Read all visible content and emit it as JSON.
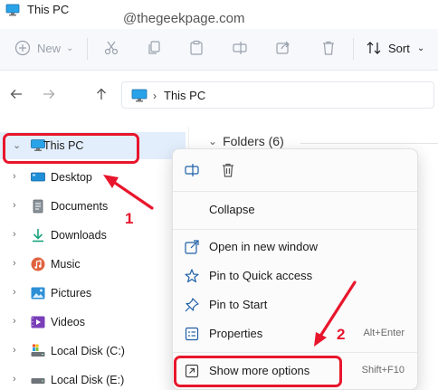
{
  "window": {
    "title": "This PC"
  },
  "watermark": "@thegeekpage.com",
  "toolbar": {
    "new_label": "New",
    "sort_label": "Sort"
  },
  "address": {
    "crumb": "This PC"
  },
  "sidebar": {
    "items": [
      {
        "label": "This PC",
        "icon": "monitor-icon",
        "expander": "⌄",
        "selected": true
      },
      {
        "label": "Desktop",
        "icon": "desktop-icon"
      },
      {
        "label": "Documents",
        "icon": "documents-icon"
      },
      {
        "label": "Downloads",
        "icon": "downloads-icon"
      },
      {
        "label": "Music",
        "icon": "music-icon"
      },
      {
        "label": "Pictures",
        "icon": "pictures-icon"
      },
      {
        "label": "Videos",
        "icon": "videos-icon"
      },
      {
        "label": "Local Disk (C:)",
        "icon": "drive-icon"
      },
      {
        "label": "Local Disk (E:)",
        "icon": "drive-icon"
      }
    ]
  },
  "main": {
    "folders_header": "Folders (6)"
  },
  "context_menu": {
    "collapse": "Collapse",
    "open_new_window": "Open in new window",
    "pin_quick_access": "Pin to Quick access",
    "pin_start": "Pin to Start",
    "properties": "Properties",
    "properties_shortcut": "Alt+Enter",
    "show_more": "Show more options",
    "show_more_shortcut": "Shift+F10"
  },
  "annotations": {
    "step1": "1",
    "step2": "2"
  },
  "colors": {
    "highlight": "#e8162c",
    "accent": "#0067c0",
    "selection": "#e3eefc"
  }
}
